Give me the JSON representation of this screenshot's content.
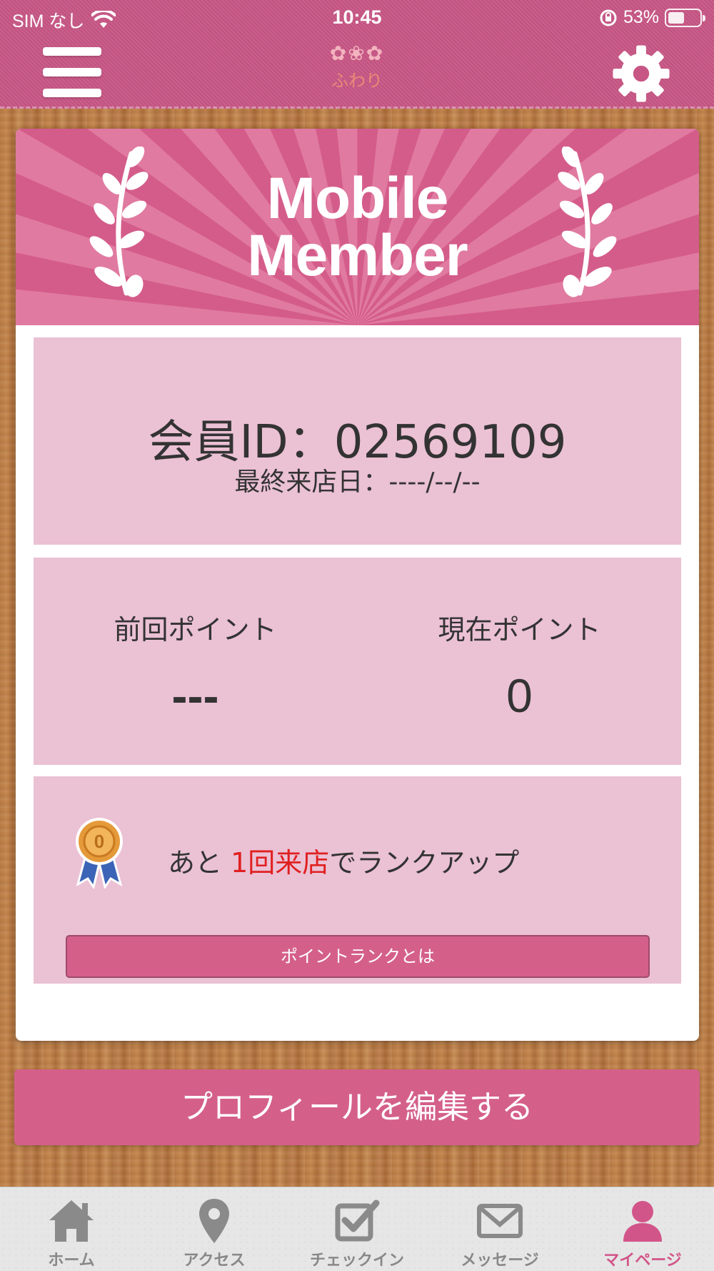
{
  "status_bar": {
    "carrier": "SIM なし",
    "time": "10:45",
    "battery_text": "53%",
    "battery_level": 0.53
  },
  "header": {
    "logo_flowers": "✿❀✿",
    "logo_text": "ふわり",
    "menu_icon": "hamburger-icon",
    "settings_icon": "gear-icon"
  },
  "banner": {
    "line1": "Mobile",
    "line2": "Member"
  },
  "member": {
    "id_text": "会員ID：02569109",
    "last_visit_text": "最終来店日：----/--/--"
  },
  "points": {
    "previous_label": "前回ポイント",
    "previous_value": "---",
    "current_label": "現在ポイント",
    "current_value": "0"
  },
  "rank": {
    "prefix": "あと ",
    "highlight": "1回来店",
    "suffix": "でランクアップ",
    "button_label": "ポイントランクとは",
    "medal_icon": "medal-icon"
  },
  "edit_profile_label": "プロフィールを編集する",
  "tabs": [
    {
      "label": "ホーム",
      "icon": "home-icon",
      "active": false
    },
    {
      "label": "アクセス",
      "icon": "map-pin-icon",
      "active": false
    },
    {
      "label": "チェックイン",
      "icon": "checkbox-icon",
      "active": false
    },
    {
      "label": "メッセージ",
      "icon": "mail-icon",
      "active": false
    },
    {
      "label": "マイページ",
      "icon": "person-icon",
      "active": true
    }
  ],
  "colors": {
    "accent": "#d4608a",
    "panel": "#ebc1d4",
    "highlight": "#e02020",
    "active_tab": "#d25589"
  }
}
